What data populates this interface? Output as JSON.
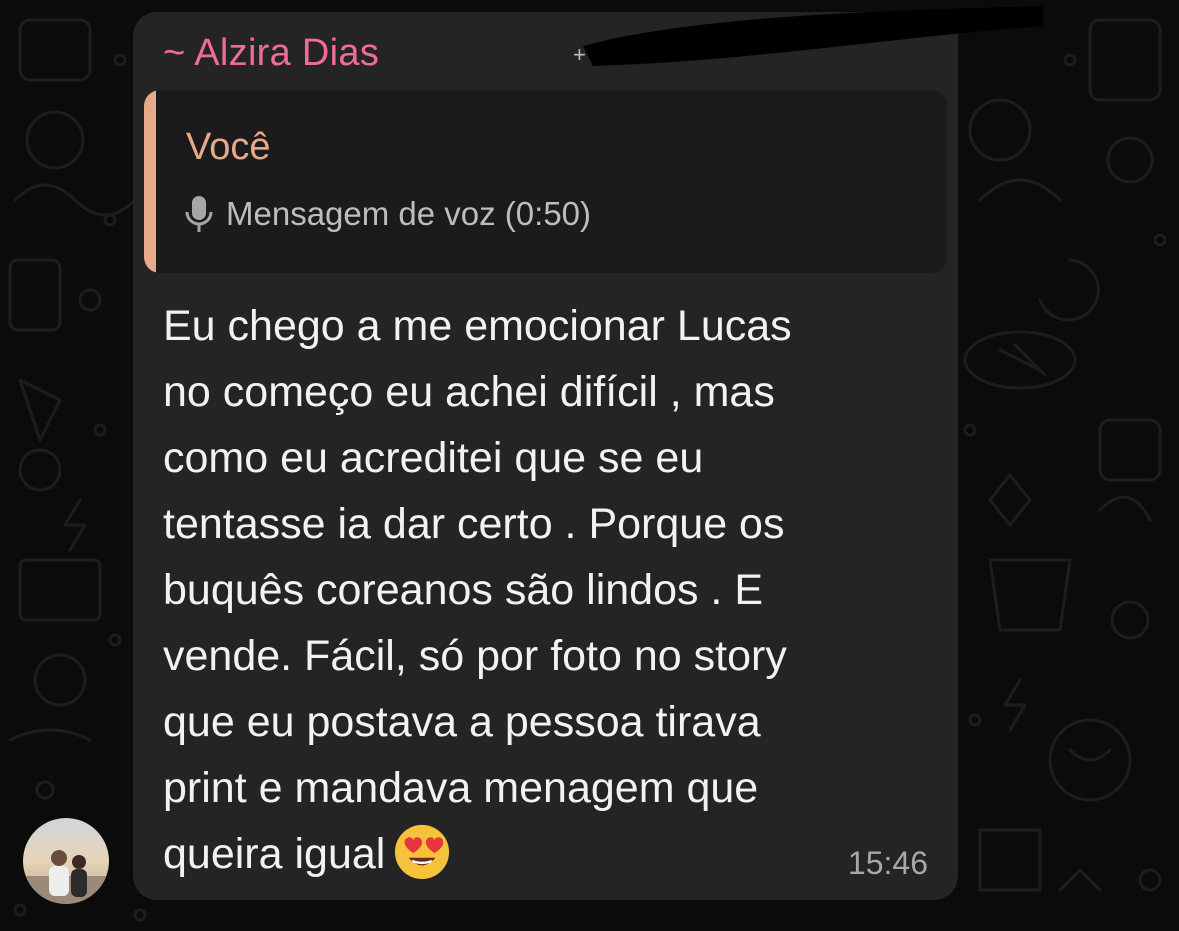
{
  "colors": {
    "background": "#0b0b0b",
    "bubble": "#242424",
    "quote_bg": "#1b1b1b",
    "sender_name": "#f06b9b",
    "quote_accent": "#e8a98a",
    "message_text": "#f2f2f2",
    "meta_text": "#a8a8a8"
  },
  "message": {
    "sender_name": "~ Alzira Dias",
    "sender_phone_partial": "+",
    "quoted": {
      "author": "Você",
      "icon": "microphone-icon",
      "text": "Mensagem de voz (0:50)"
    },
    "body": "Eu chego a me emocionar Lucas\nno começo eu achei difícil , mas\ncomo eu acreditei que se eu\ntentasse ia dar certo . Porque  os\nbuquês coreanos são lindos . E\nvende. Fácil, só por foto no story\nque eu postava a pessoa tirava\nprint e mandava menagem  que\nqueira igual",
    "emoji": "smiling-face-with-heart-eyes",
    "time": "15:46"
  },
  "avatar": {
    "icon": "contact-avatar"
  }
}
